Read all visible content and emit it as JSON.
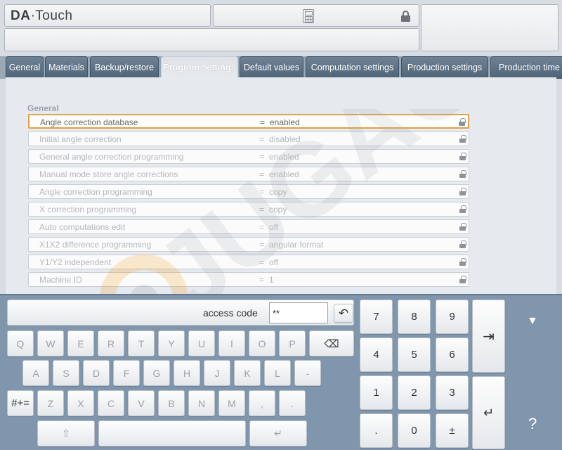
{
  "header": {
    "logo_bold": "DA",
    "logo_sep": "·",
    "logo_rest": "Touch"
  },
  "tabs": [
    {
      "label": "General"
    },
    {
      "label": "Materials"
    },
    {
      "label": "Backup/restore"
    },
    {
      "label": "Program settings",
      "active": true
    },
    {
      "label": "Default values"
    },
    {
      "label": "Computation settings"
    },
    {
      "label": "Production settings"
    },
    {
      "label": "Production time"
    }
  ],
  "settings": {
    "group_label": "General",
    "rows": [
      {
        "label": "Angle correction database",
        "value": "enabled",
        "selected": true
      },
      {
        "label": "Initial angle correction",
        "value": "disabled"
      },
      {
        "label": "General angle correction programming",
        "value": "enabled"
      },
      {
        "label": "Manual mode store angle corrections",
        "value": "enabled"
      },
      {
        "label": "Angle correction programming",
        "value": "copy"
      },
      {
        "label": "X correction programming",
        "value": "copy"
      },
      {
        "label": "Auto computations edit",
        "value": "off"
      },
      {
        "label": "X1X2 difference programming",
        "value": "angular format"
      },
      {
        "label": "Y1/Y2 independent",
        "value": "off"
      },
      {
        "label": "Machine ID",
        "value": "1"
      }
    ],
    "eq_sign": "="
  },
  "keyboard": {
    "access_label": "access code",
    "access_value": "**",
    "row1": [
      "Q",
      "W",
      "E",
      "R",
      "T",
      "Y",
      "U",
      "I",
      "O",
      "P"
    ],
    "row2": [
      "A",
      "S",
      "D",
      "F",
      "G",
      "H",
      "J",
      "K",
      "L",
      "-"
    ],
    "row3_symbol": "#+=",
    "row3": [
      "Z",
      "X",
      "C",
      "V",
      "B",
      "N",
      "M",
      ",",
      "."
    ],
    "shift": "⇧",
    "enter": "↵",
    "backspace": "⌫",
    "undo": "↶"
  },
  "numpad": {
    "keys": [
      "7",
      "8",
      "9",
      "4",
      "5",
      "6",
      "1",
      "2",
      "3",
      ".",
      "0",
      "±"
    ],
    "tab_glyph": "⇥",
    "enter_glyph": "↵"
  },
  "side": {
    "down_glyph": "▼",
    "help_glyph": "?"
  },
  "watermark_text": "JUGAO"
}
